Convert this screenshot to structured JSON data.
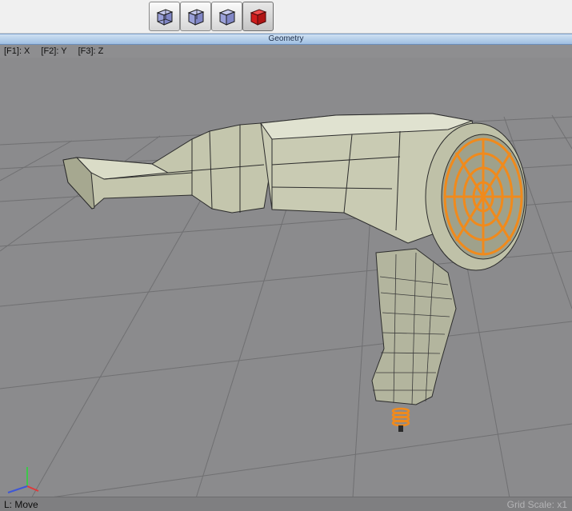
{
  "toolbar": {
    "buttons": [
      {
        "name": "wireframe-cube-1",
        "color": "#9aa0d8"
      },
      {
        "name": "wireframe-cube-2",
        "color": "#9aa0d8"
      },
      {
        "name": "wireframe-cube-3",
        "color": "#9aa0d8"
      },
      {
        "name": "solid-cube",
        "color": "#d01c1c"
      }
    ]
  },
  "panel": {
    "title": "Geometry"
  },
  "viewport": {
    "axis_keys": [
      "[F1]: X",
      "[F2]: Y",
      "[F3]: Z"
    ],
    "colors": {
      "background": "#8b8b8d",
      "grid": "#6f6f71",
      "mesh_fill": "#c8c9b3",
      "mesh_edge": "#2c2c2c",
      "selection": "#f08a1c"
    }
  },
  "status": {
    "left": "L: Move",
    "right": "Grid Scale: x1"
  }
}
